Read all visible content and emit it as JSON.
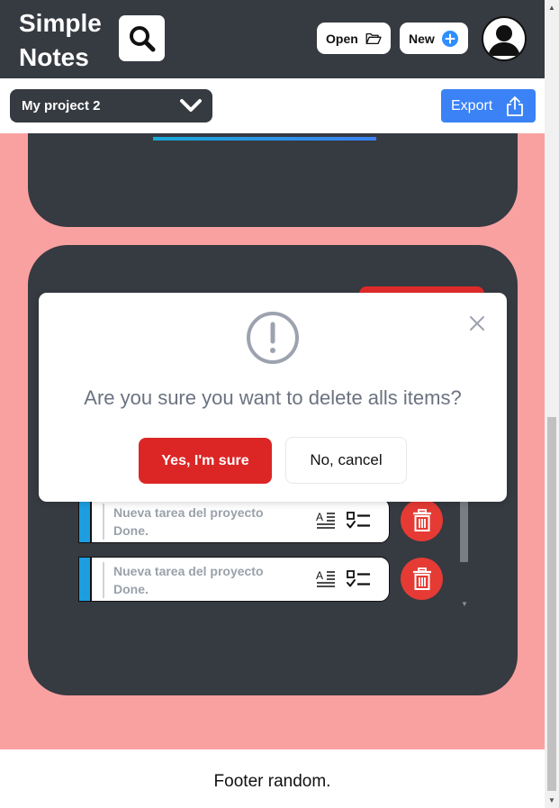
{
  "header": {
    "app_title_line1": "Simple",
    "app_title_line2": "Notes",
    "search_icon": "search-icon",
    "open_label": "Open",
    "open_icon": "folder-open-icon",
    "new_label": "New",
    "new_icon": "plus-circle-icon",
    "avatar_icon": "user-avatar-icon"
  },
  "toolbar": {
    "project_selected": "My project 2",
    "export_label": "Export",
    "export_icon": "share-icon"
  },
  "tasks": [
    {
      "title_line1": "Nueva tarea del proyecto",
      "title_line2": "Done."
    },
    {
      "title_line1": "Nueva tarea del proyecto",
      "title_line2": "Done."
    }
  ],
  "modal": {
    "message": "Are you sure you want to delete alls items?",
    "confirm_label": "Yes, I'm sure",
    "cancel_label": "No, cancel"
  },
  "footer": {
    "text": "Footer random."
  },
  "colors": {
    "header_bg": "#363a41",
    "main_bg": "#f9a1a1",
    "accent_blue": "#3b82f6",
    "danger_red": "#dc2626"
  }
}
